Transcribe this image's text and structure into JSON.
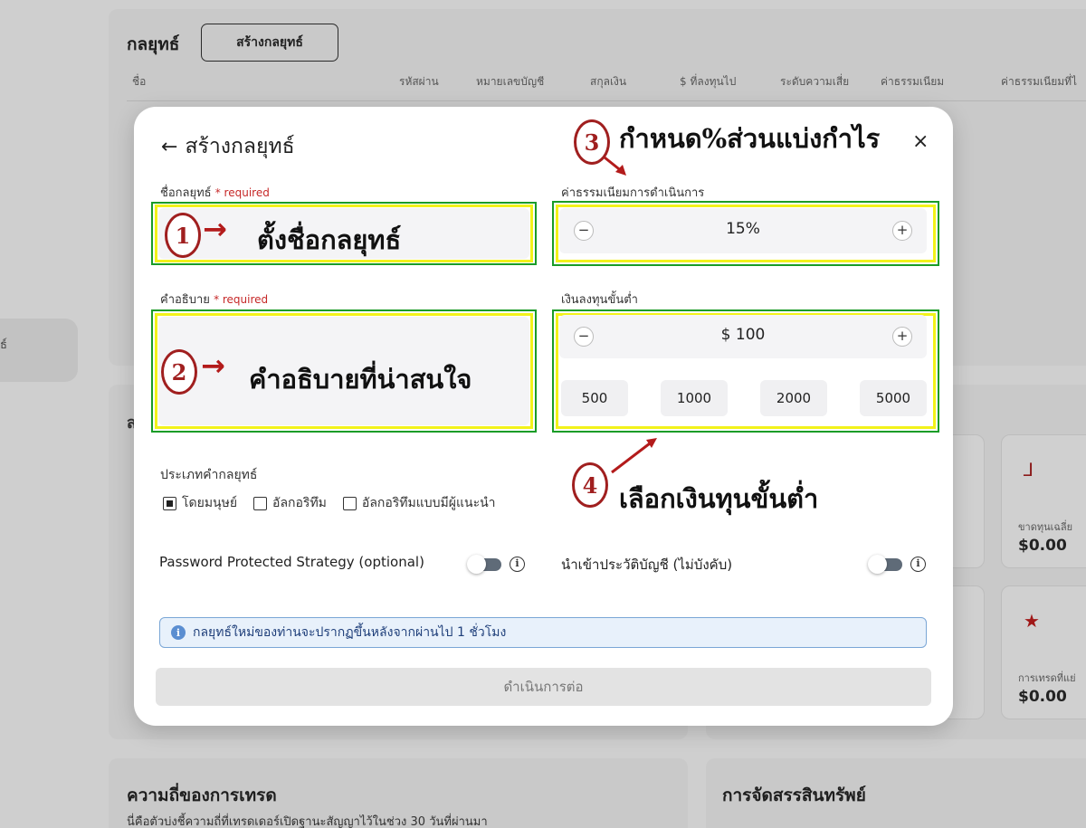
{
  "background": {
    "sidebar_frag": "ธ์",
    "title": "กลยุทธ์",
    "create_button": "สร้างกลยุทธ์",
    "table_headers": [
      "ชื่อ",
      "รหัสผ่าน",
      "หมายเลขบัญชี",
      "สกุลเงิน",
      "$ ที่ลงทุนไป",
      "ระดับความเสี่ย",
      "ค่าธรรมเนียม",
      "ค่าธรรมเนียมที่ไ"
    ],
    "section_frag": "ส",
    "stats": [
      {
        "label": "ขาดทุนเฉลี่ย",
        "value": "$0.00",
        "icon": "loss-icon"
      },
      {
        "label": "การเทรดที่แย่",
        "value": "$0.00",
        "icon": "star-icon"
      }
    ],
    "freq_title": "ความถี่ของการเทรด",
    "freq_sub": "นี่คือตัวบ่งชี้ความถี่ที่เทรดเดอร์เปิดฐานะสัญญาไว้ในช่วง 30 วันที่ผ่านมา",
    "alloc_title": "การจัดสรรสินทรัพย์"
  },
  "modal": {
    "back_arrow": "←",
    "title": "สร้างกลยุทธ์",
    "close": "×",
    "name_label": "ชื่อกลยุทธ์",
    "required": "* required",
    "desc_label": "คำอธิบาย",
    "fee_label": "ค่าธรรมเนียมการดำเนินการ",
    "fee_value": "15%",
    "min_label": "เงินลงทุนขั้นต่ำ",
    "min_value": "$ 100",
    "minus": "−",
    "plus": "+",
    "chips": [
      "500",
      "1000",
      "2000",
      "5000"
    ],
    "type_label": "ประเภทคำกลยุทธ์",
    "type_options": [
      {
        "label": "โดยมนุษย์",
        "checked": true
      },
      {
        "label": "อัลกอริทึม",
        "checked": false
      },
      {
        "label": "อัลกอริทึมแบบมีผู้แนะนำ",
        "checked": false
      }
    ],
    "password_label": "Password Protected Strategy (optional)",
    "history_label": "นำเข้าประวัติบัญชี (ไม่บังคับ)",
    "info_glyph": "i",
    "info_text": "กลยุทธ์ใหม่ของท่านจะปรากฏขึ้นหลังจากผ่านไป 1 ชั่วโมง",
    "continue": "ดำเนินการต่อ"
  },
  "annotations": {
    "n1": "1",
    "n2": "2",
    "n3": "3",
    "n4": "4",
    "a1": "ตั้งชื่อกลยุทธ์",
    "a2": "คำอธิบายที่น่าสนใจ",
    "a3": "กำหนด%ส่วนแบ่งกำไร",
    "a4": "เลือกเงินทุนขั้นต่ำ",
    "arrow": "→",
    "colors": {
      "outline_green": "#1a9c27",
      "outline_yellow": "#f2f21a",
      "marker_red": "#a01f1f"
    }
  }
}
